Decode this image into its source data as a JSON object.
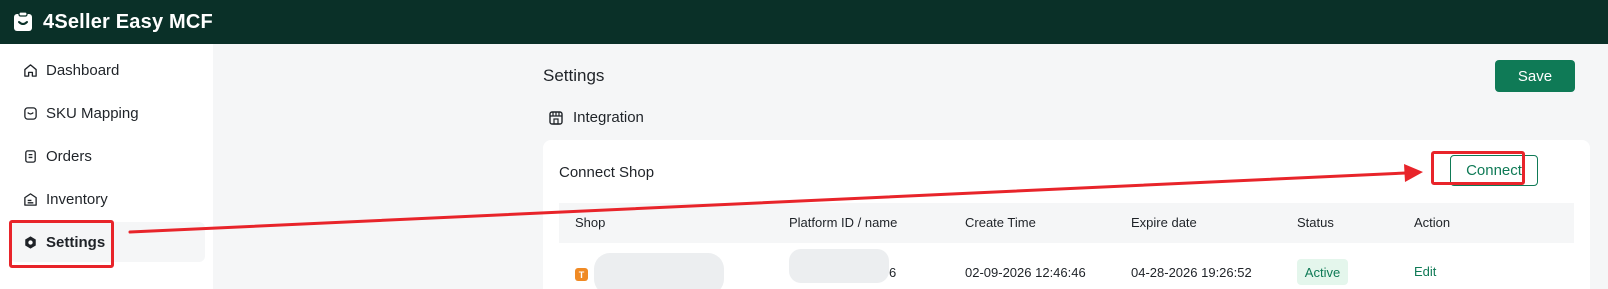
{
  "app": {
    "title": "4Seller Easy MCF"
  },
  "sidebar": {
    "items": [
      {
        "label": "Dashboard",
        "icon": "home-icon"
      },
      {
        "label": "SKU Mapping",
        "icon": "mapping-icon"
      },
      {
        "label": "Orders",
        "icon": "orders-icon"
      },
      {
        "label": "Inventory",
        "icon": "inventory-icon"
      },
      {
        "label": "Settings",
        "icon": "settings-icon",
        "active": true
      }
    ]
  },
  "page": {
    "title": "Settings",
    "save_label": "Save"
  },
  "integration": {
    "heading": "Integration",
    "icon": "store-icon"
  },
  "connect_shop": {
    "title": "Connect Shop",
    "connect_label": "Connect",
    "columns": [
      "Shop",
      "Platform ID / name",
      "Create Time",
      "Expire date",
      "Status",
      "Action"
    ],
    "rows": [
      {
        "shop_icon": "T",
        "platform_id_suffix": "6",
        "create_time": "02-09-2026 12:46:46",
        "expire_date": "04-28-2026 19:26:52",
        "status": "Active",
        "action": "Edit"
      }
    ]
  },
  "colors": {
    "topbar": "#0a3028",
    "accent": "#0f7a56",
    "annotation": "#e8242a",
    "status_bg": "#e4f6ec"
  }
}
